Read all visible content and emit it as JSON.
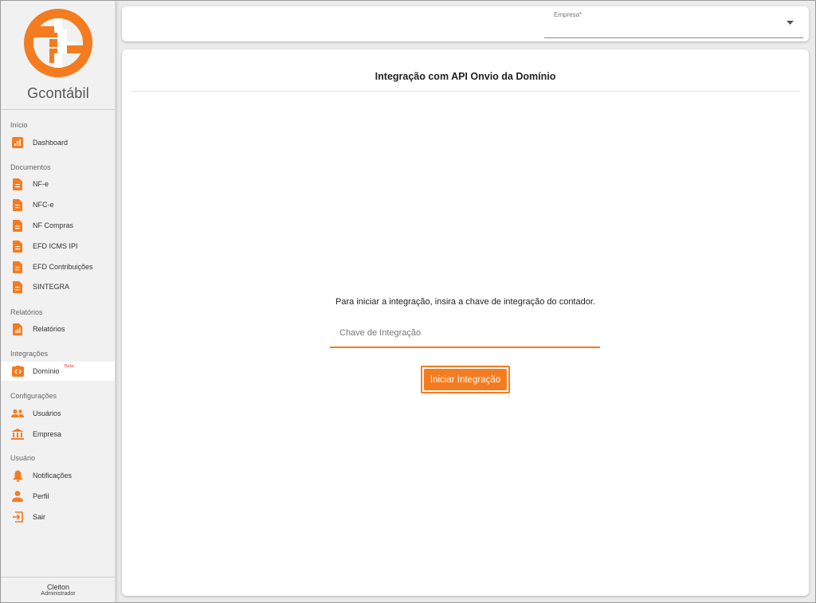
{
  "brand": {
    "name": "Gcontábil",
    "accent": "#f47c20"
  },
  "sidebar": {
    "sections": [
      {
        "title": "Início",
        "items": [
          {
            "label": "Dashboard",
            "icon": "dashboard-icon"
          }
        ]
      },
      {
        "title": "Documentos",
        "items": [
          {
            "label": "NF-e",
            "icon": "document-icon"
          },
          {
            "label": "NFC-e",
            "icon": "document-icon"
          },
          {
            "label": "NF Compras",
            "icon": "document-icon"
          },
          {
            "label": "EFD ICMS IPI",
            "icon": "document-icon"
          },
          {
            "label": "EFD Contribuições",
            "icon": "document-icon"
          },
          {
            "label": "SINTEGRA",
            "icon": "document-icon"
          }
        ]
      },
      {
        "title": "Relatórios",
        "items": [
          {
            "label": "Relatórios",
            "icon": "report-icon"
          }
        ]
      },
      {
        "title": "Integrações",
        "items": [
          {
            "label": "Domínio",
            "badge": "Beta",
            "icon": "integration-icon",
            "active": true
          }
        ]
      },
      {
        "title": "Configurações",
        "items": [
          {
            "label": "Usuários",
            "icon": "users-icon"
          },
          {
            "label": "Empresa",
            "icon": "bank-icon"
          }
        ]
      },
      {
        "title": "Usuário",
        "items": [
          {
            "label": "Notificações",
            "icon": "bell-icon"
          },
          {
            "label": "Perfil",
            "icon": "person-icon"
          },
          {
            "label": "Sair",
            "icon": "logout-icon"
          }
        ]
      }
    ],
    "user": {
      "name": "Cleiton",
      "role": "Administrador"
    }
  },
  "topbar": {
    "empresa_label": "Empresa*",
    "empresa_value": ""
  },
  "main": {
    "title": "Integração com API Onvio da Domínio",
    "instruction": "Para iniciar a integração, insira a chave de integração do contador.",
    "key_placeholder": "Chave de Integração",
    "key_value": "",
    "start_button": "Iniciar Integração"
  }
}
